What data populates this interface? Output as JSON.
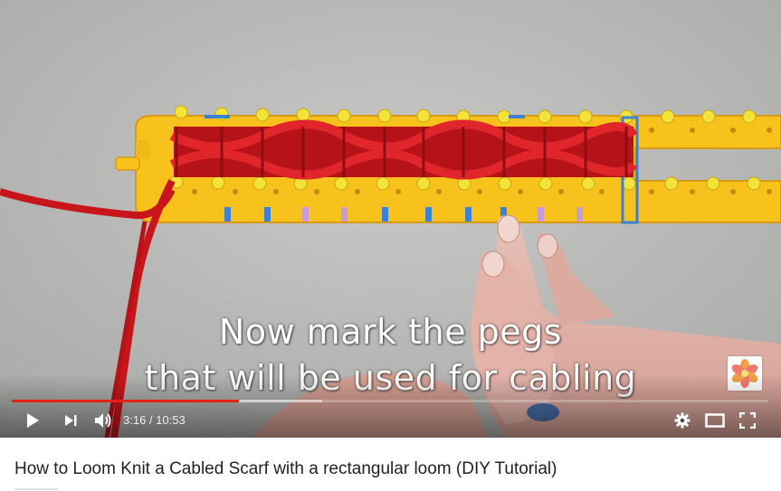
{
  "video": {
    "caption_line1": "Now mark the pegs",
    "caption_line2": "that will be used for cabling",
    "current_time": "3:16",
    "duration": "10:53",
    "played_fraction": 0.3,
    "buffered_fraction": 0.41
  },
  "controls": {
    "play_icon": "play-icon",
    "next_icon": "skip-next-icon",
    "volume_icon": "volume-icon",
    "settings_icon": "gear-icon",
    "theater_icon": "theater-mode-icon",
    "fullscreen_icon": "fullscreen-icon"
  },
  "colors": {
    "progress_played": "#e62117",
    "loom": "#f7c21c",
    "yarn": "#d0151b",
    "peg": "#f2e23a",
    "band_blue": "#3b82d6",
    "band_purple": "#c79ad8"
  },
  "page": {
    "title": "How to Loom Knit a Cabled Scarf with a rectangular loom (DIY Tutorial)"
  }
}
